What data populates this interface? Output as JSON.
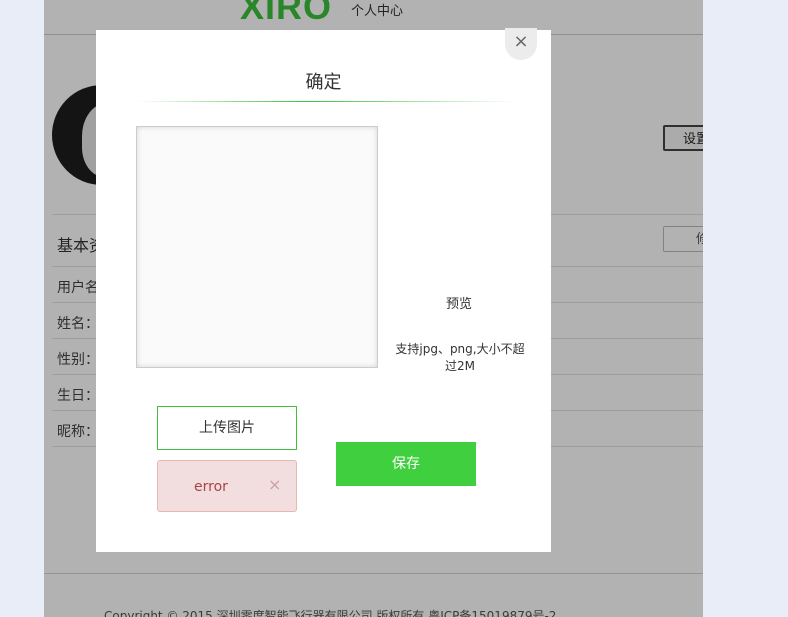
{
  "background_page": {
    "logo": "XIRO",
    "logo_subtitle": "个人中心",
    "settings_button": "设置",
    "section_title": "基本资",
    "edit_button": "修",
    "fields": [
      "用户名",
      "姓名：",
      "性别：",
      "生日：",
      "昵称："
    ],
    "copyright": "Copyright © 2015 深圳零度智能飞行器有限公司 版权所有 粤ICP备15019879号-2"
  },
  "modal": {
    "close_icon": "×",
    "title": "确定",
    "preview_label": "预览",
    "support_text": "支持jpg、png,大小不超过2M",
    "upload_button": "上传图片",
    "error_text": "error",
    "error_close_icon": "×",
    "save_button": "保存"
  },
  "colors": {
    "accent_green": "#3fcf3f",
    "error_bg": "#f2dede",
    "error_text": "#a94442"
  }
}
